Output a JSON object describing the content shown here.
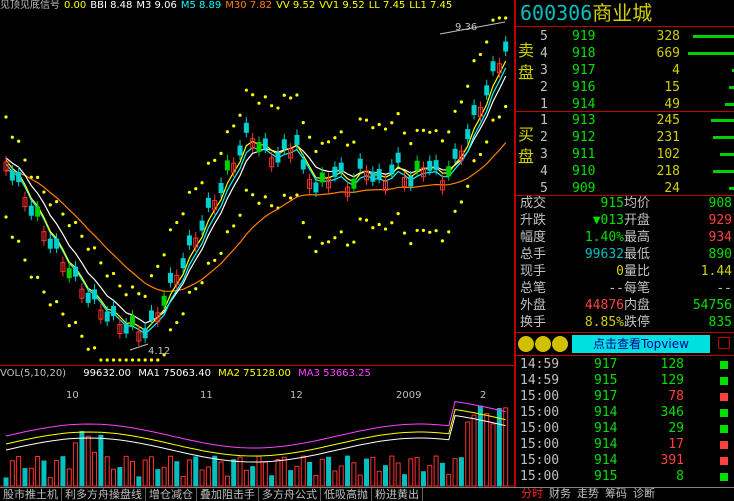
{
  "indicator_bar": {
    "title": "见顶见底信号",
    "items": [
      {
        "label": "0.00",
        "color": "#ffff00"
      },
      {
        "label": "BBI 8.48",
        "color": "#ffffff"
      },
      {
        "label": "M3 9.06",
        "color": "#ffffff"
      },
      {
        "label": "M5 8.89",
        "color": "#00ffff"
      },
      {
        "label": "M30 7.82",
        "color": "#ff8000"
      },
      {
        "label": "VV 9.52",
        "color": "#ffff00"
      },
      {
        "label": "VV1 9.52",
        "color": "#ffff00"
      },
      {
        "label": "LL 7.45",
        "color": "#ffff00"
      },
      {
        "label": "LL1 7.45",
        "color": "#ffff00"
      }
    ]
  },
  "chart": {
    "high_label": "9.36",
    "low_label": "4.12",
    "year_label": "2009",
    "month_labels": [
      "10",
      "11",
      "12",
      "2"
    ]
  },
  "volume": {
    "label": "VOL(5,10,20)",
    "vol": "99632.00",
    "ma1_label": "MA1",
    "ma1": "75063.40",
    "ma2_label": "MA2",
    "ma2": "75128.00",
    "ma3_label": "MA3",
    "ma3": "53663.25"
  },
  "stock": {
    "code": "600306",
    "name": "商业城"
  },
  "sell_label": [
    "卖",
    "盘"
  ],
  "buy_label": [
    "买",
    "盘"
  ],
  "sell_orders": [
    {
      "level": "5",
      "price": "919",
      "volume": "328",
      "bar": 0.9
    },
    {
      "level": "4",
      "price": "918",
      "volume": "669",
      "bar": 1.0
    },
    {
      "level": "3",
      "price": "917",
      "volume": "4",
      "bar": 0.05
    },
    {
      "level": "2",
      "price": "916",
      "volume": "15",
      "bar": 0.1
    },
    {
      "level": "1",
      "price": "914",
      "volume": "49",
      "bar": 0.2
    }
  ],
  "buy_orders": [
    {
      "level": "1",
      "price": "913",
      "volume": "245",
      "bar": 0.5
    },
    {
      "level": "2",
      "price": "912",
      "volume": "231",
      "bar": 0.45
    },
    {
      "level": "3",
      "price": "911",
      "volume": "102",
      "bar": 0.3
    },
    {
      "level": "4",
      "price": "910",
      "volume": "218",
      "bar": 0.45
    },
    {
      "level": "5",
      "price": "909",
      "volume": "24",
      "bar": 0.1
    }
  ],
  "stats": [
    {
      "l1": "成交",
      "v1": "915",
      "c1": "#00e000",
      "l2": "均价",
      "v2": "908",
      "c2": "#00e000"
    },
    {
      "l1": "升跌",
      "v1": "▼013",
      "c1": "#00e000",
      "l2": "开盘",
      "v2": "929",
      "c2": "#ff4040"
    },
    {
      "l1": "幅度",
      "v1": "1.40%",
      "c1": "#00e000",
      "l2": "最高",
      "v2": "934",
      "c2": "#ff4040"
    },
    {
      "l1": "总手",
      "v1": "99632",
      "c1": "#00c0c0",
      "l2": "最低",
      "v2": "890",
      "c2": "#00e000"
    },
    {
      "l1": "现手",
      "v1": "0",
      "c1": "#d0d000",
      "l2": "量比",
      "v2": "1.44",
      "c2": "#d0d000"
    },
    {
      "l1": "总笔",
      "v1": "--",
      "c1": "#c0c0c0",
      "l2": "每笔",
      "v2": "--",
      "c2": "#c0c0c0"
    },
    {
      "l1": "外盘",
      "v1": "44876",
      "c1": "#ff4040",
      "l2": "内盘",
      "v2": "54756",
      "c2": "#00e000"
    },
    {
      "l1": "换手",
      "v1": "8.85%",
      "c1": "#d0d000",
      "l2": "跌停",
      "v2": "835",
      "c2": "#00e000"
    }
  ],
  "topview": {
    "button_label": "点击查看Topview"
  },
  "trades": [
    {
      "time": "14:59",
      "price": "917",
      "volume": "128",
      "vcolor": "#00e000"
    },
    {
      "time": "14:59",
      "price": "915",
      "volume": "129",
      "vcolor": "#00e000"
    },
    {
      "time": "15:00",
      "price": "917",
      "volume": "78",
      "vcolor": "#ff4040"
    },
    {
      "time": "15:00",
      "price": "914",
      "volume": "346",
      "vcolor": "#00e000"
    },
    {
      "time": "15:00",
      "price": "914",
      "volume": "29",
      "vcolor": "#00e000"
    },
    {
      "time": "15:00",
      "price": "914",
      "volume": "17",
      "vcolor": "#ff4040"
    },
    {
      "time": "15:00",
      "price": "914",
      "volume": "391",
      "vcolor": "#ff4040"
    },
    {
      "time": "15:00",
      "price": "915",
      "volume": "8",
      "vcolor": "#00e000"
    }
  ],
  "bottom_tabs": [
    "股市推土机",
    "利多方舟操盘线",
    "增仓减仓",
    "叠加阻击手",
    "多方舟公式",
    "低吸高抛",
    "粉进黄出"
  ],
  "right_tabs": [
    {
      "label": "分时",
      "active": true
    },
    {
      "label": "财务",
      "active": false
    },
    {
      "label": "走势",
      "active": false
    },
    {
      "label": "筹码",
      "active": false
    },
    {
      "label": "诊断",
      "active": false
    }
  ],
  "colors": {
    "up": "#ff3030",
    "down": "#00d0d0",
    "grid": "#c00000",
    "accent": "#00e0e0"
  }
}
